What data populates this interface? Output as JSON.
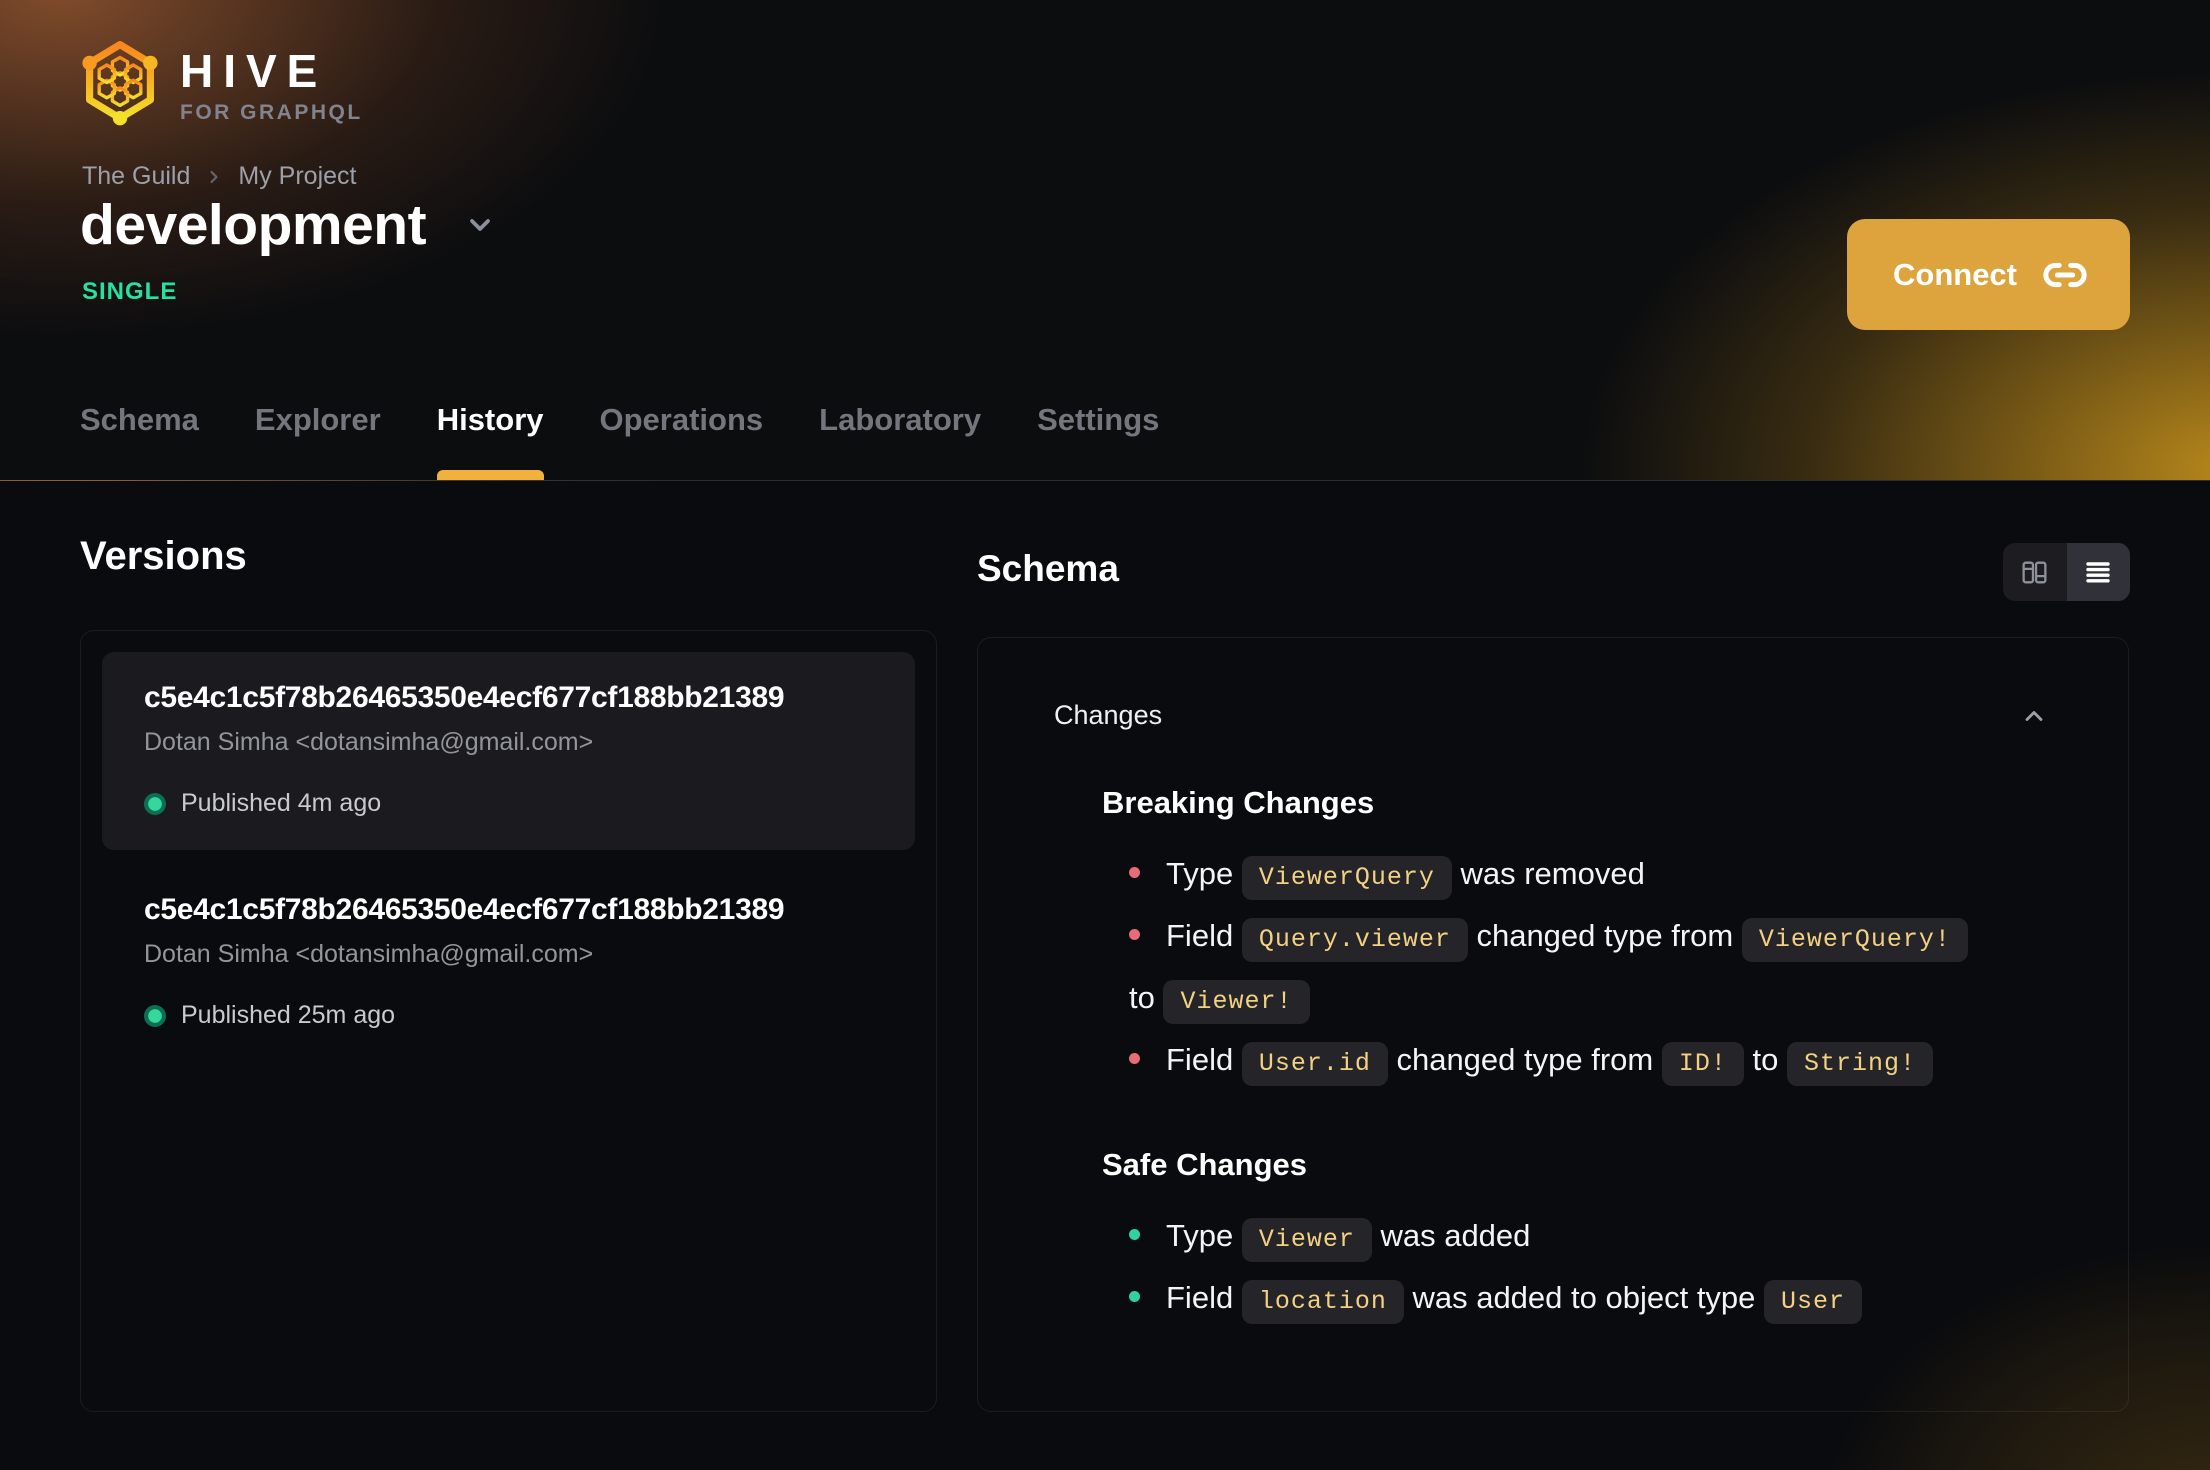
{
  "brand": {
    "name": "HIVE",
    "tagline": "FOR GRAPHQL"
  },
  "breadcrumb": {
    "items": [
      "The Guild",
      "My Project"
    ]
  },
  "target": {
    "name": "development",
    "badge": "SINGLE"
  },
  "header": {
    "connect_label": "Connect"
  },
  "tabs": [
    {
      "label": "Schema",
      "active": false
    },
    {
      "label": "Explorer",
      "active": false
    },
    {
      "label": "History",
      "active": true
    },
    {
      "label": "Operations",
      "active": false
    },
    {
      "label": "Laboratory",
      "active": false
    },
    {
      "label": "Settings",
      "active": false
    }
  ],
  "versions": {
    "heading": "Versions",
    "items": [
      {
        "hash": "c5e4c1c5f78b26465350e4ecf677cf188bb21389",
        "author": "Dotan Simha <dotansimha@gmail.com>",
        "status": "Published 4m ago",
        "selected": true
      },
      {
        "hash": "c5e4c1c5f78b26465350e4ecf677cf188bb21389",
        "author": "Dotan Simha <dotansimha@gmail.com>",
        "status": "Published 25m ago",
        "selected": false
      }
    ]
  },
  "schema": {
    "heading": "Schema",
    "view_modes": [
      "split-view",
      "list-view"
    ],
    "active_view": "list-view",
    "changes_label": "Changes",
    "sections": [
      {
        "title": "Breaking Changes",
        "kind": "breaking",
        "items": [
          [
            {
              "text": "Type "
            },
            {
              "code": "ViewerQuery"
            },
            {
              "text": " was removed"
            }
          ],
          [
            {
              "text": "Field "
            },
            {
              "code": "Query.viewer"
            },
            {
              "text": " changed type from "
            },
            {
              "code": "ViewerQuery!"
            },
            {
              "text": " to "
            },
            {
              "code": "Viewer!"
            }
          ],
          [
            {
              "text": "Field "
            },
            {
              "code": "User.id"
            },
            {
              "text": " changed type from "
            },
            {
              "code": "ID!"
            },
            {
              "text": " to "
            },
            {
              "code": "String!"
            }
          ]
        ]
      },
      {
        "title": "Safe Changes",
        "kind": "safe",
        "items": [
          [
            {
              "text": "Type "
            },
            {
              "code": "Viewer"
            },
            {
              "text": " was added"
            }
          ],
          [
            {
              "text": "Field "
            },
            {
              "code": "location"
            },
            {
              "text": " was added to object type "
            },
            {
              "code": "User"
            }
          ]
        ]
      }
    ]
  },
  "colors": {
    "accent": "#f0b23c",
    "connect": "#dda43e",
    "badge_green": "#27e0a3",
    "breaking_bullet": "#e66c77",
    "safe_bullet": "#2fd2a0",
    "chip_text": "#f2d183"
  }
}
